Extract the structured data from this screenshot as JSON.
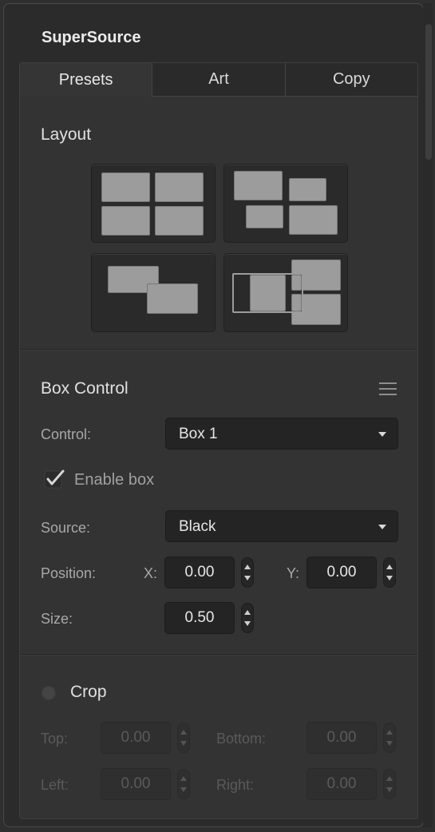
{
  "panel": {
    "title": "SuperSource"
  },
  "tabs": [
    {
      "label": "Presets",
      "active": true
    },
    {
      "label": "Art",
      "active": false
    },
    {
      "label": "Copy",
      "active": false
    }
  ],
  "layout": {
    "label": "Layout",
    "presets": [
      {
        "icon": "four-box-layout-icon"
      },
      {
        "icon": "staggered-four-box-layout-icon"
      },
      {
        "icon": "two-box-overlap-layout-icon"
      },
      {
        "icon": "vertical-split-layout-icon"
      }
    ]
  },
  "box_control": {
    "label": "Box Control",
    "menu_icon": "hamburger-menu-icon",
    "control_label": "Control:",
    "control_value": "Box 1",
    "enable_label": "Enable box",
    "enable_checked": true,
    "source_label": "Source:",
    "source_value": "Black",
    "position_label": "Position:",
    "x_label": "X:",
    "x_value": "0.00",
    "y_label": "Y:",
    "y_value": "0.00",
    "size_label": "Size:",
    "size_value": "0.50"
  },
  "crop": {
    "label": "Crop",
    "enabled": false,
    "top_label": "Top:",
    "top_value": "0.00",
    "bottom_label": "Bottom:",
    "bottom_value": "0.00",
    "left_label": "Left:",
    "left_value": "0.00",
    "right_label": "Right:",
    "right_value": "0.00"
  },
  "colors": {
    "panel_bg": "#2b2b2b",
    "field_bg": "#242424",
    "box_fill": "#9c9c9c",
    "disabled_text": "#5a5a5a"
  }
}
